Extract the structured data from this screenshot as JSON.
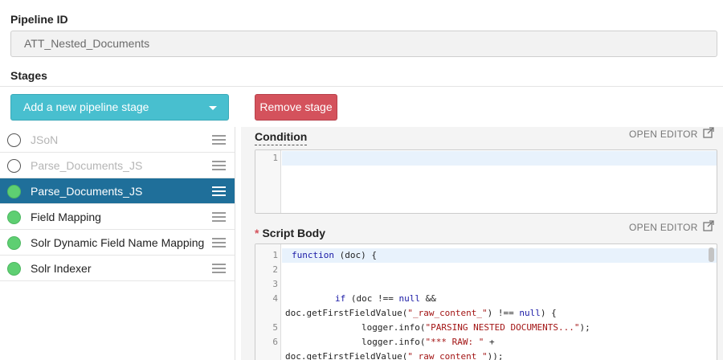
{
  "pipeline": {
    "id_label": "Pipeline ID",
    "id_value": "ATT_Nested_Documents"
  },
  "stages": {
    "label": "Stages",
    "add_button_label": "Add a new pipeline stage",
    "remove_button_label": "Remove stage",
    "items": [
      {
        "name": "JSoN",
        "enabled": false,
        "selected": false
      },
      {
        "name": "Parse_Documents_JS",
        "enabled": false,
        "selected": false
      },
      {
        "name": "Parse_Documents_JS",
        "enabled": true,
        "selected": true
      },
      {
        "name": "Field Mapping",
        "enabled": true,
        "selected": false
      },
      {
        "name": "Solr Dynamic Field Name Mapping",
        "enabled": true,
        "selected": false
      },
      {
        "name": "Solr Indexer",
        "enabled": true,
        "selected": false
      }
    ]
  },
  "condition": {
    "label": "Condition",
    "open_editor_label": "OPEN EDITOR",
    "line_numbers": [
      "1"
    ]
  },
  "script_body": {
    "required_marker": "*",
    "label": "Script Body",
    "open_editor_label": "OPEN EDITOR",
    "line_numbers": [
      "1",
      "2",
      "3",
      "4",
      "5",
      "6"
    ],
    "code": {
      "l1_kw": "function",
      "l1_rest": " (doc) {",
      "l4_kw": "if",
      "l4_a": " (doc !== ",
      "l4_null": "null",
      "l4_b": " &&",
      "l4w_a": "doc.getFirstFieldValue(",
      "l4w_str": "\"_raw_content_\"",
      "l4w_b": ") !== ",
      "l4w_null": "null",
      "l4w_c": ") {",
      "l5_a": "logger.info(",
      "l5_str": "\"PARSING NESTED DOCUMENTS...\"",
      "l5_b": ");",
      "l6_a": "logger.info(",
      "l6_str": "\"*** RAW: \"",
      "l6_b": " +",
      "l6w_a": "doc.getFirstFieldValue(",
      "l6w_str": "\"_raw_content_\"",
      "l6w_b": "));"
    }
  },
  "icons": {
    "dropdown": "caret-down-icon",
    "open_editor": "external-link-icon",
    "drag_handle": "drag-handle-icon",
    "status": "status-dot-icon"
  },
  "colors": {
    "add_button": "#48bfcf",
    "remove_button": "#d4525c",
    "selected_row": "#1f6f9a",
    "enabled_dot": "#5ecf72"
  }
}
